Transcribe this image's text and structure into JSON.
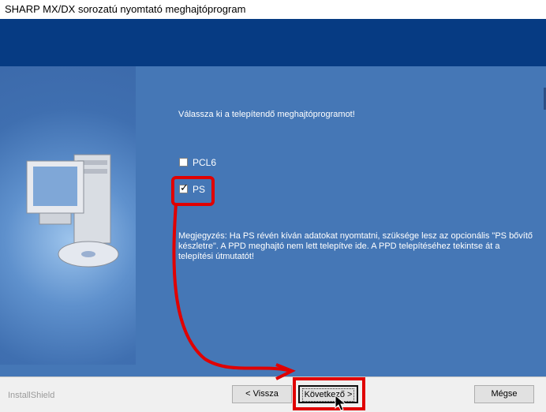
{
  "window": {
    "title": "SHARP MX/DX sorozatú nyomtató meghajtóprogram"
  },
  "content": {
    "instruction": "Válassza ki a telepítendő meghajtóprogramot!",
    "options": [
      {
        "label": "PCL6",
        "checked": false
      },
      {
        "label": "PS",
        "checked": true
      }
    ],
    "note": "Megjegyzés: Ha PS révén kíván adatokat nyomtatni, szüksége lesz az opcionális \"PS bővítő készletre\". A PPD meghajtó nem lett telepítve ide. A PPD telepítéséhez tekintse át a telepítési útmutatót!"
  },
  "footer": {
    "brand": "InstallShield",
    "back_label": "< Vissza",
    "next_label": "Következő >",
    "cancel_label": "Mégse"
  },
  "colors": {
    "header_band": "#063b83",
    "panel_blue": "#4577b6",
    "highlight_red": "#e00000"
  },
  "icons": {
    "illustration": "computer-with-disc-icon",
    "cursor": "mouse-pointer-icon"
  }
}
